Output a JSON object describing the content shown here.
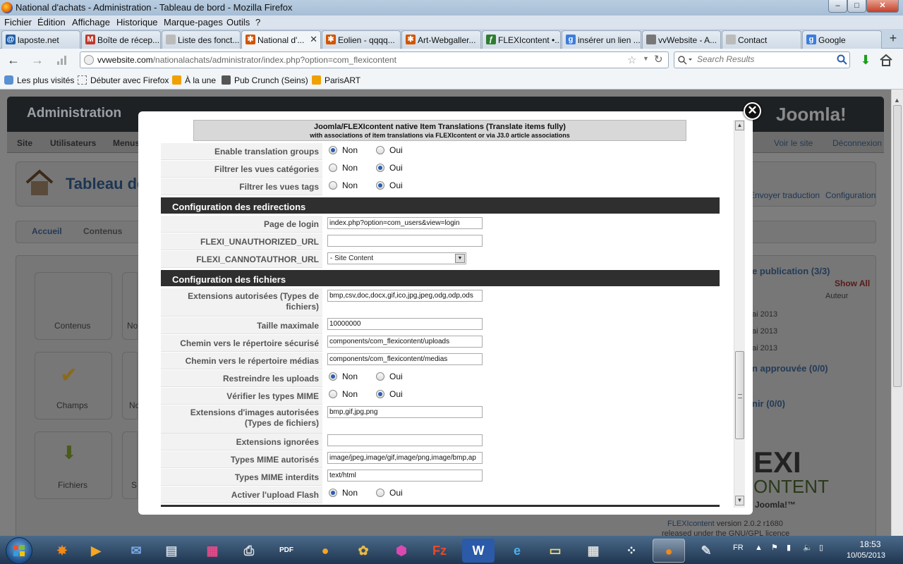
{
  "window": {
    "title": "National d'achats - Administration - Tableau de bord - Mozilla Firefox"
  },
  "menubar": [
    "Fichier",
    "Édition",
    "Affichage",
    "Historique",
    "Marque-pages",
    "Outils",
    "?"
  ],
  "tabs": [
    {
      "label": "laposte.net",
      "color": "#1f5fa8",
      "icon": "laposte-icon"
    },
    {
      "label": "Boîte de récep...",
      "color": "#c0392b",
      "icon": "gmail-icon"
    },
    {
      "label": "Liste des fonct...",
      "color": "#999999",
      "icon": "page-icon"
    },
    {
      "label": "National d'...",
      "color": "#d35400",
      "icon": "joomla-icon",
      "active": true
    },
    {
      "label": "Eolien - qqqq...",
      "color": "#d35400",
      "icon": "joomla-icon"
    },
    {
      "label": "Art-Webgaller...",
      "color": "#d35400",
      "icon": "joomla-icon"
    },
    {
      "label": "FLEXIcontent •...",
      "color": "#2e7d32",
      "icon": "flexi-icon"
    },
    {
      "label": "insérer un lien ...",
      "color": "#3b7ddd",
      "icon": "google-icon"
    },
    {
      "label": "vvWebsite - A...",
      "color": "#777777",
      "icon": "page-icon"
    },
    {
      "label": "Contact",
      "color": "#999999",
      "icon": "page-icon"
    },
    {
      "label": "Google",
      "color": "#3b7ddd",
      "icon": "google-icon"
    }
  ],
  "nav": {
    "url_domain": "vvwebsite.com",
    "url_path": "/nationalachats/administrator/index.php?option=com_flexicontent",
    "search_placeholder": "Search Results"
  },
  "bookmarks": [
    "Les plus visités",
    "Débuter avec Firefox",
    "À la une",
    "Pub Crunch (Seins)",
    "ParisART"
  ],
  "joomla": {
    "header": "Administration",
    "logo": "Joomla!",
    "menu": [
      "Site",
      "Utilisateurs",
      "Menus"
    ],
    "page_title": "Tableau de",
    "tabs": [
      "Accueil",
      "Contenus"
    ],
    "tiles": [
      "Contenus",
      "Champs",
      "Fichiers",
      "No",
      "No",
      "S"
    ],
    "right_links": [
      "Voir le site",
      "Déconnexion"
    ],
    "toolbar": [
      "Envoyer traduction",
      "Configuration"
    ],
    "publication": "e publication (3/3)",
    "show_all": "Show All",
    "auteur": "Auteur",
    "dates": [
      "ai 2013",
      "ai 2013",
      "ai 2013"
    ],
    "approved": "n approuvée (0/0)",
    "tenir": "nir (0/0)",
    "flexi_logo1": "EXI",
    "flexi_logo2": "ONTENT",
    "flexi_logo3": "Joomla!™",
    "version_prefix": "FLEXIcontent",
    "version": "version 2.0.2 r1680",
    "license": "released under the GNU/GPL licence"
  },
  "modal": {
    "header_title": "Joomla/FLEXIcontent native Item Translations (Translate items fully)",
    "header_sub": "with associations of item translations via FLEXIcontent or via J3.0 article associations",
    "opt_non": "Non",
    "opt_oui": "Oui",
    "rows_trans": [
      {
        "label": "Enable translation groups",
        "value": "Non"
      },
      {
        "label": "Filtrer les vues catégories",
        "value": "Oui"
      },
      {
        "label": "Filtrer les vues tags",
        "value": "Oui"
      }
    ],
    "section_redirect": "Configuration des redirections",
    "redirect": {
      "login_label": "Page de login",
      "login_value": "index.php?option=com_users&view=login",
      "unauth_label": "FLEXI_UNAUTHORIZED_URL",
      "unauth_value": "",
      "cannot_label": "FLEXI_CANNOTAUTHOR_URL",
      "cannot_value": "- Site Content"
    },
    "section_files": "Configuration des fichiers",
    "files": {
      "ext_label": "Extensions autorisées (Types de fichiers)",
      "ext_value": "bmp,csv,doc,docx,gif,ico,jpg,jpeg,odg,odp,ods",
      "max_label": "Taille maximale",
      "max_value": "10000000",
      "secure_label": "Chemin vers le répertoire sécurisé",
      "secure_value": "components/com_flexicontent/uploads",
      "media_label": "Chemin vers le répertoire médias",
      "media_value": "components/com_flexicontent/medias",
      "restrict_label": "Restreindre les uploads",
      "restrict_value": "Non",
      "mime_check_label": "Vérifier les types MIME",
      "mime_check_value": "Oui",
      "img_ext_label": "Extensions d'images autorisées (Types de fichiers)",
      "img_ext_value": "bmp,gif,jpg,png",
      "ignored_label": "Extensions ignorées",
      "ignored_value": "",
      "mime_allowed_label": "Types MIME autorisés",
      "mime_allowed_value": "image/jpeg,image/gif,image/png,image/bmp,ap",
      "mime_forbid_label": "Types MIME interdits",
      "mime_forbid_value": "text/html",
      "flash_label": "Activer l'upload Flash",
      "flash_value": "Non"
    }
  },
  "taskbar": {
    "lang": "FR",
    "time": "18:53",
    "date": "10/05/2013"
  }
}
